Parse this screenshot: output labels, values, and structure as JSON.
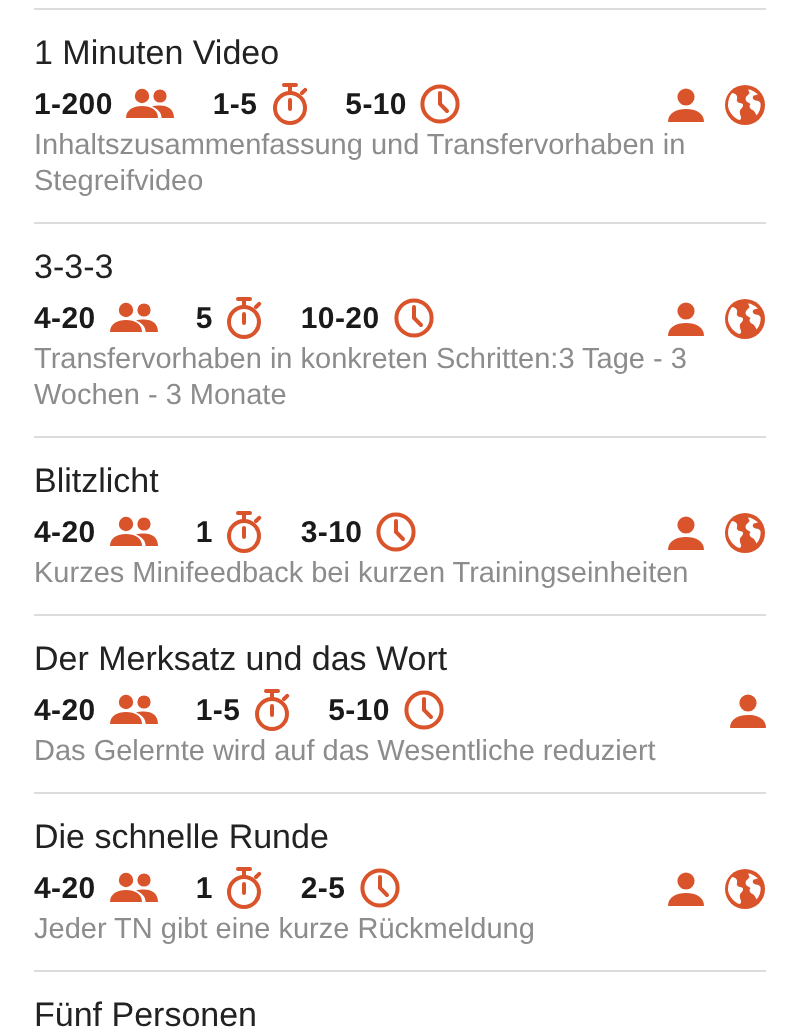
{
  "items": [
    {
      "title": "1 Minuten Video",
      "participants": "1-200",
      "preparation": "1-5",
      "duration": "5-10",
      "individual": true,
      "online": true,
      "description": "Inhaltszusammenfassung und Transfervorhaben in Stegreifvideo"
    },
    {
      "title": "3-3-3",
      "participants": "4-20",
      "preparation": "5",
      "duration": "10-20",
      "individual": true,
      "online": true,
      "description": "Transfervorhaben in konkreten Schritten:3 Tage - 3 Wochen - 3 Monate"
    },
    {
      "title": "Blitzlicht",
      "participants": "4-20",
      "preparation": "1",
      "duration": "3-10",
      "individual": true,
      "online": true,
      "description": "Kurzes Minifeedback bei kurzen Trainingseinheiten"
    },
    {
      "title": "Der Merksatz und das Wort",
      "participants": "4-20",
      "preparation": "1-5",
      "duration": "5-10",
      "individual": true,
      "online": false,
      "description": "Das Gelernte wird auf das Wesentliche reduziert"
    },
    {
      "title": "Die schnelle Runde",
      "participants": "4-20",
      "preparation": "1",
      "duration": "2-5",
      "individual": true,
      "online": true,
      "description": "Jeder TN gibt eine kurze Rückmeldung"
    },
    {
      "title": "Fünf Personen"
    }
  ]
}
